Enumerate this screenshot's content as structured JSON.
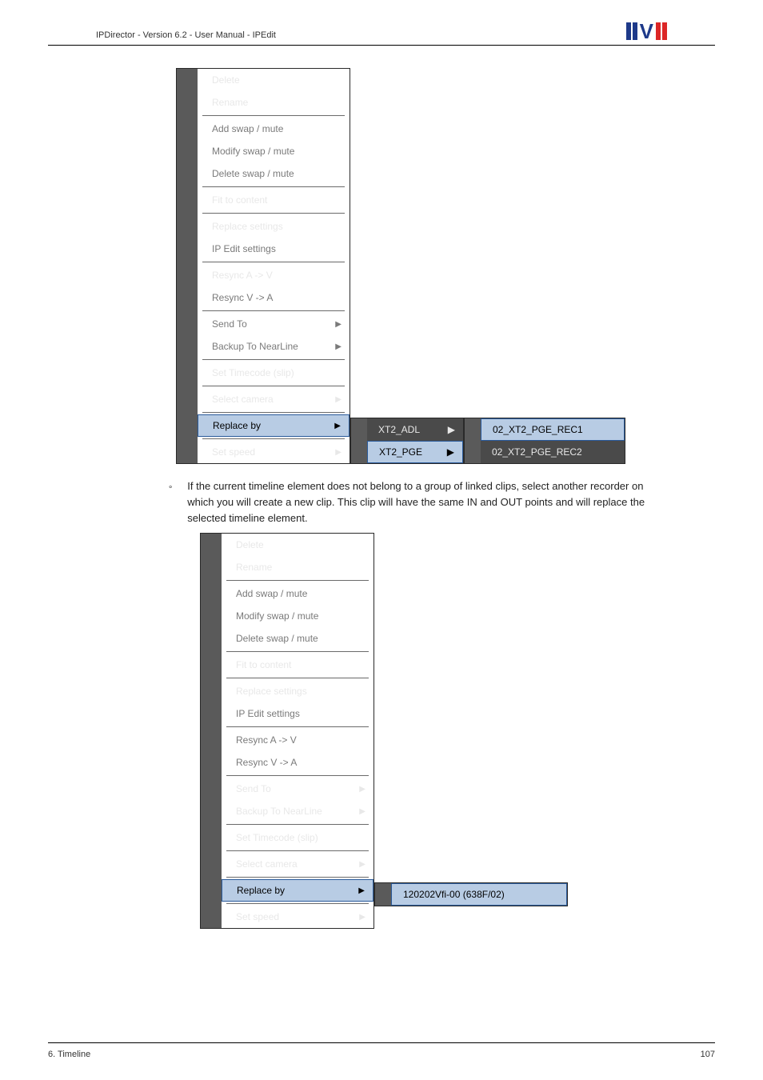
{
  "header": {
    "title": "IPDirector - Version 6.2 - User Manual - IPEdit"
  },
  "menu1": {
    "items": {
      "delete": "Delete",
      "rename": "Rename",
      "add_swap": "Add swap / mute",
      "modify_swap": "Modify swap / mute",
      "delete_swap": "Delete swap / mute",
      "fit": "Fit to content",
      "replace_settings": "Replace settings",
      "ip_edit": "IP Edit settings",
      "resync_av": "Resync A -> V",
      "resync_va": "Resync V -> A",
      "send_to": "Send To",
      "backup": "Backup To NearLine",
      "set_tc": "Set Timecode (slip)",
      "select_camera": "Select camera",
      "replace_by": "Replace by",
      "set_speed": "Set speed"
    },
    "sub": {
      "xt2_adl": "XT2_ADL",
      "xt2_pge": "XT2_PGE"
    },
    "final": {
      "rec1": "02_XT2_PGE_REC1",
      "rec2": "02_XT2_PGE_REC2"
    }
  },
  "paragraph": "If the current timeline element does not belong to a group of linked clips, select another recorder on which you will create a new clip. This clip will have the same IN and OUT points and will replace the selected timeline element.",
  "menu2": {
    "items": {
      "delete": "Delete",
      "rename": "Rename",
      "add_swap": "Add swap / mute",
      "modify_swap": "Modify swap / mute",
      "delete_swap": "Delete swap / mute",
      "fit": "Fit to content",
      "replace_settings": "Replace settings",
      "ip_edit": "IP Edit settings",
      "resync_av": "Resync A -> V",
      "resync_va": "Resync V -> A",
      "send_to": "Send To",
      "backup": "Backup To NearLine",
      "set_tc": "Set Timecode (slip)",
      "select_camera": "Select camera",
      "replace_by": "Replace by",
      "set_speed": "Set speed"
    },
    "final": {
      "rec": "120202Vfi-00 (638F/02)"
    }
  },
  "footer": {
    "left": "6. Timeline",
    "right": "107"
  }
}
